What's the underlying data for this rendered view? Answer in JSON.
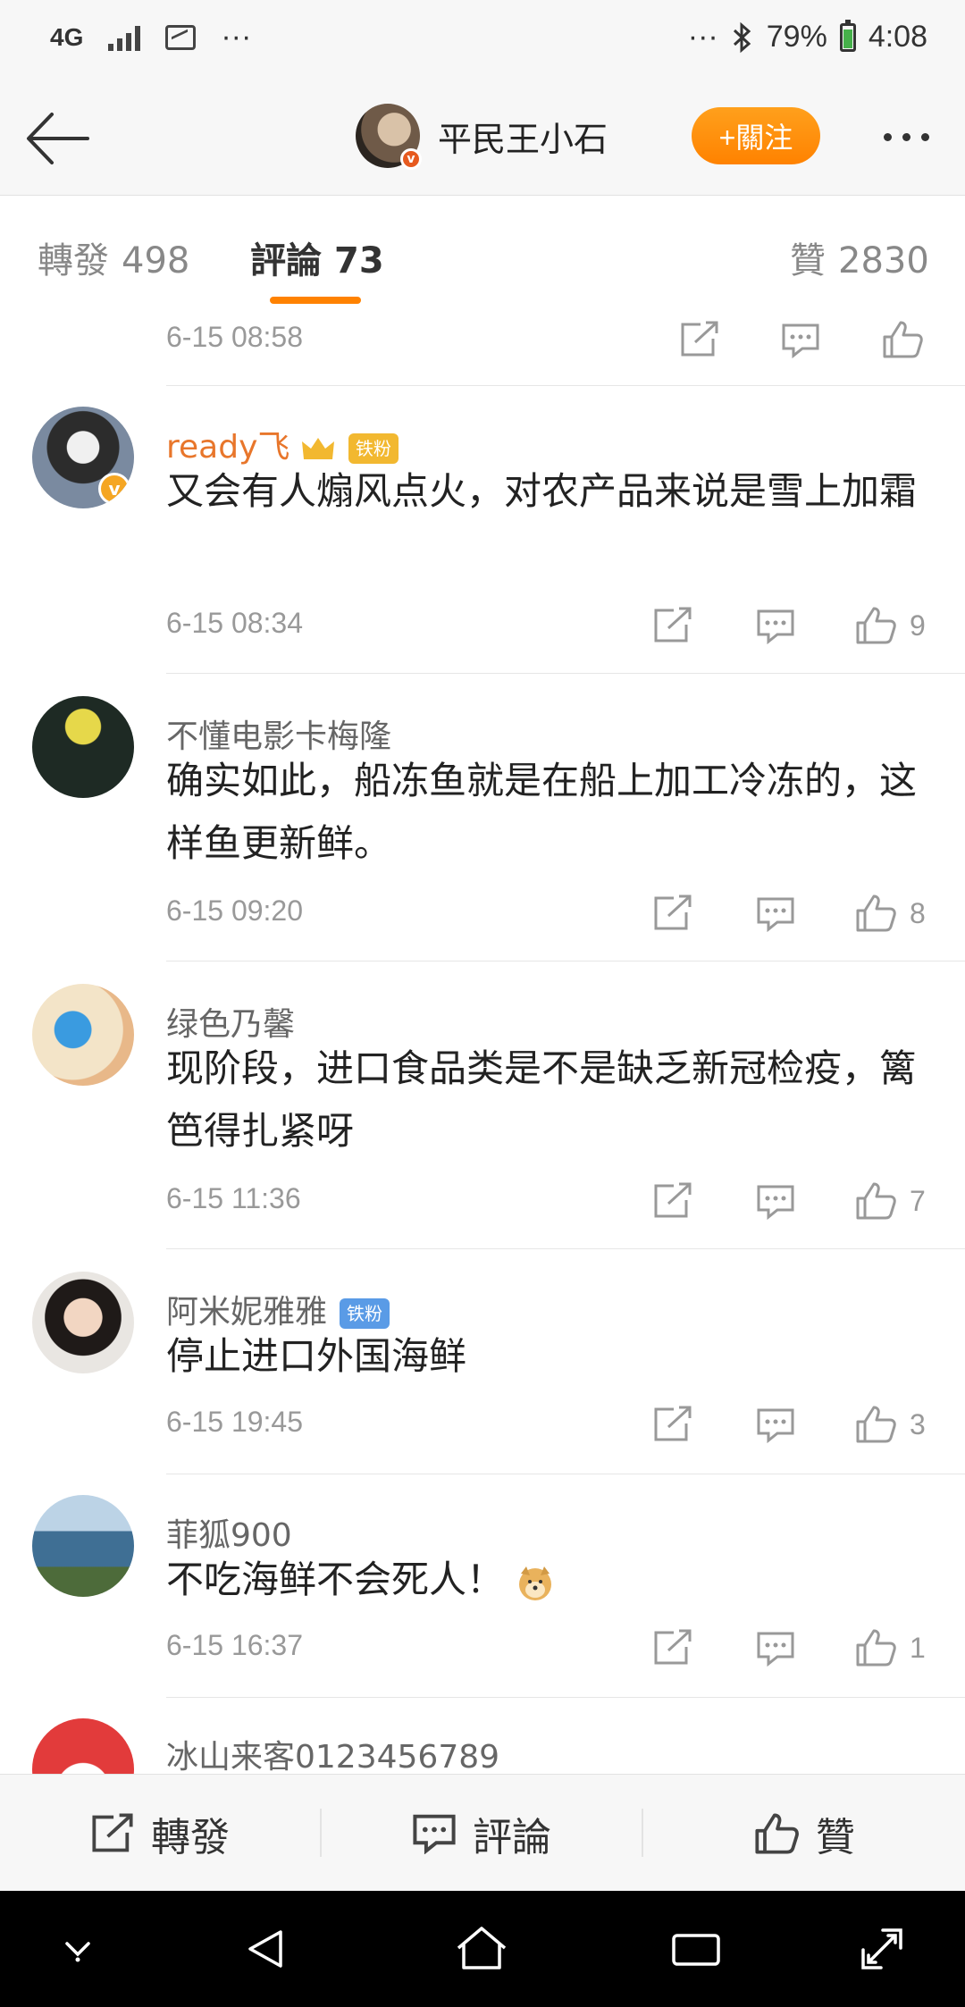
{
  "status": {
    "network": "4G",
    "dots_left": "···",
    "dots_right": "···",
    "battery": "79%",
    "battery_level": 0.79,
    "time": "4:08"
  },
  "header": {
    "author": "平民王小石",
    "follow_label": "+關注"
  },
  "tabs": {
    "repost_label": "轉發",
    "repost_count": "498",
    "comment_label": "評論",
    "comment_count": "73",
    "like_label": "贊",
    "like_count": "2830"
  },
  "top_time": "6-15 08:58",
  "comments": [
    {
      "name": "ready飞",
      "badge": "铁粉",
      "text": "又会有人煽风点火，对农产品来说是雪上加霜",
      "time": "6-15 08:34",
      "likes": "9"
    },
    {
      "name": "不懂电影卡梅隆",
      "text": "确实如此，船冻鱼就是在船上加工冷冻的，这样鱼更新鲜。",
      "time": "6-15 09:20",
      "likes": "8"
    },
    {
      "name": "绿色乃馨",
      "text": "现阶段，进口食品类是不是缺乏新冠检疫，篱笆得扎紧呀",
      "time": "6-15 11:36",
      "likes": "7"
    },
    {
      "name": "阿米妮雅雅",
      "badge": "铁粉",
      "text": "停止进口外国海鲜",
      "time": "6-15 19:45",
      "likes": "3"
    },
    {
      "name": "菲狐900",
      "text": "不吃海鲜不会死人！",
      "time": "6-15 16:37",
      "likes": "1"
    },
    {
      "name": "冰山来客0123456789"
    }
  ],
  "bottom": {
    "repost": "轉發",
    "comment": "評論",
    "like": "贊"
  }
}
